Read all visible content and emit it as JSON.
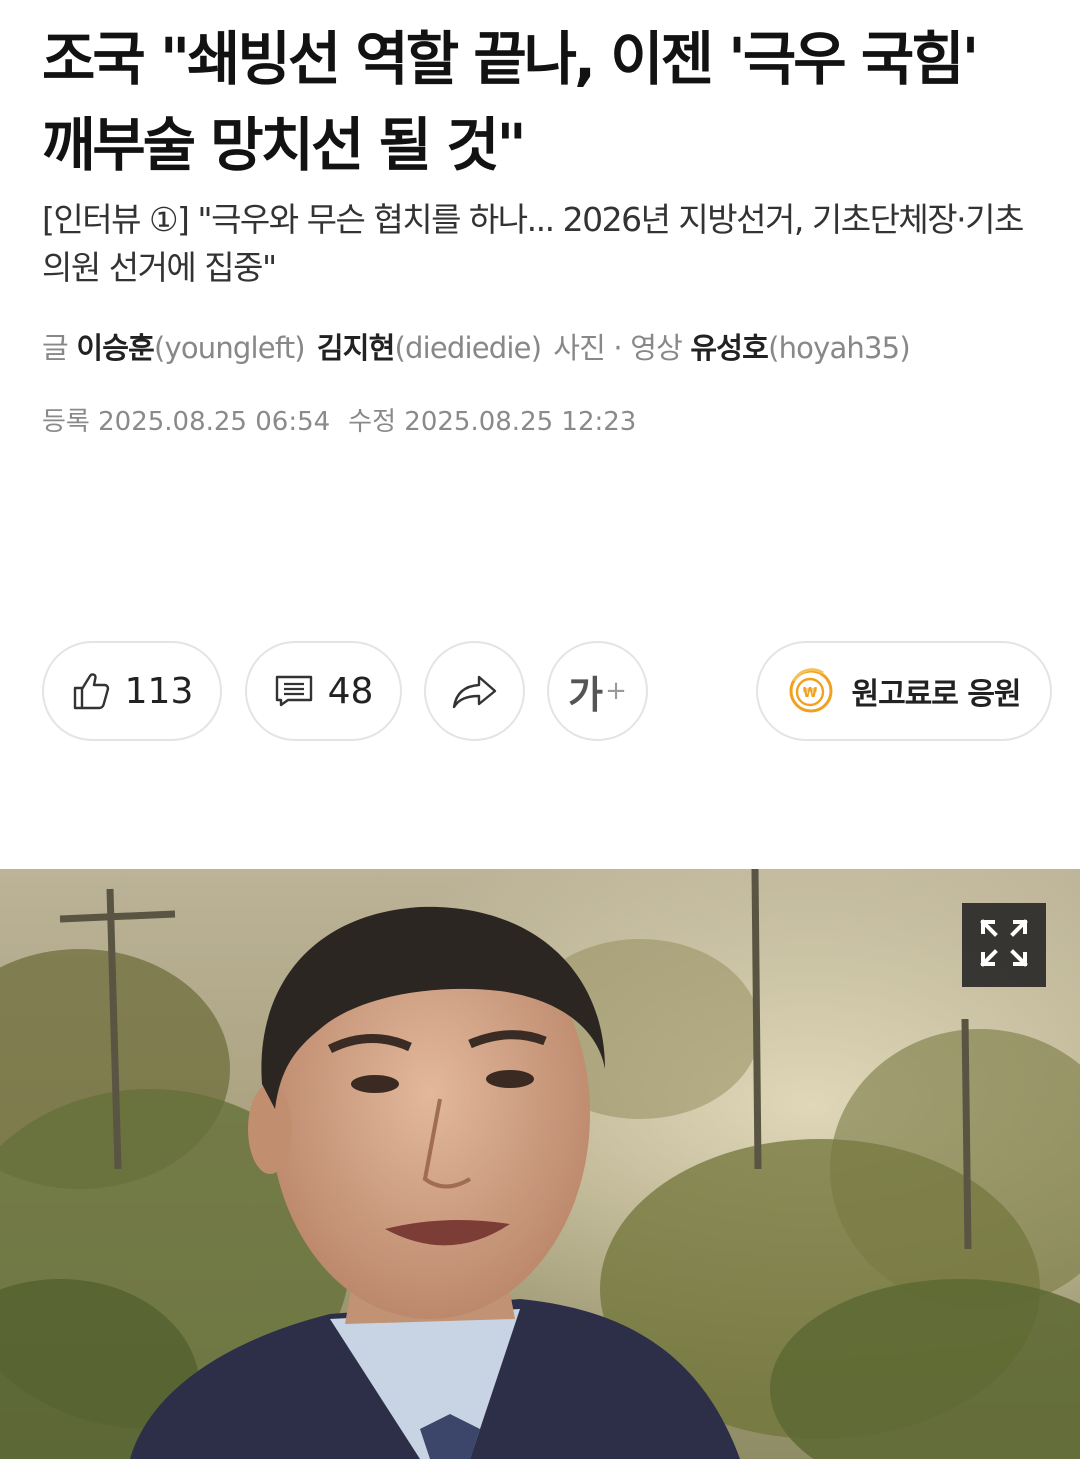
{
  "article": {
    "headline": "조국 \"쇄빙선 역할 끝나, 이젠 '극우 국힘' 깨부술 망치선 될 것\"",
    "subheadline": "[인터뷰 ①] \"극우와 무슨 협치를 하나... 2026년 지방선거, 기초단체장·기초의원 선거에 집중\"",
    "byline": {
      "writer_label": "글",
      "writers": [
        {
          "name": "이승훈",
          "id": "(youngleft)"
        },
        {
          "name": "김지현",
          "id": "(diediedie)"
        }
      ],
      "photo_label": "사진 · 영상",
      "photographer": {
        "name": "유성호",
        "id": "(hoyah35)"
      }
    },
    "dates": {
      "registered_label": "등록",
      "registered": "2025.08.25 06:54",
      "modified_label": "수정",
      "modified": "2025.08.25 12:23"
    }
  },
  "actions": {
    "like_count": "113",
    "comment_count": "48",
    "font_size_label": "가",
    "font_size_plus": "+",
    "support_label": "원고료로 응원",
    "support_icon_symbol": "₩"
  },
  "icons": {
    "like": "thumbs-up-icon",
    "comment": "comment-icon",
    "share": "share-arrow-icon",
    "expand": "expand-icon",
    "coin": "won-coin-icon"
  },
  "colors": {
    "coin_accent": "#f2a11f",
    "text_primary": "#121212",
    "text_muted": "#888888",
    "pill_border": "#e4e4e4"
  }
}
